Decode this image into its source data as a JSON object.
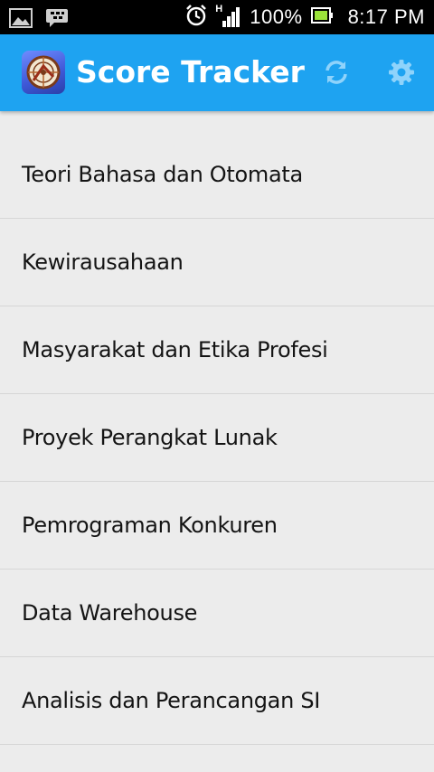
{
  "status_bar": {
    "battery_percent": "100%",
    "time": "8:17 PM",
    "network_type": "H",
    "icons": [
      "gallery-icon",
      "bbm-icon",
      "alarm-icon",
      "signal-icon",
      "battery-icon"
    ]
  },
  "app_bar": {
    "title": "Score Tracker",
    "background_color": "#1ea3f1",
    "actions": [
      "refresh-icon",
      "settings-icon"
    ]
  },
  "courses": [
    {
      "name": "Teori Bahasa dan Otomata"
    },
    {
      "name": "Kewirausahaan"
    },
    {
      "name": "Masyarakat dan Etika Profesi"
    },
    {
      "name": "Proyek Perangkat Lunak"
    },
    {
      "name": "Pemrograman Konkuren"
    },
    {
      "name": "Data Warehouse"
    },
    {
      "name": "Analisis dan Perancangan SI"
    }
  ]
}
